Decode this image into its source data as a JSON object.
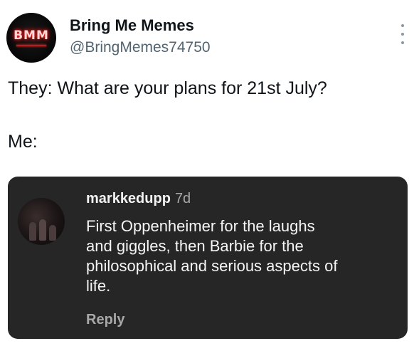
{
  "post": {
    "avatar_logo_text": "BMM",
    "display_name": "Bring Me Memes",
    "handle": "@BringMemes74750",
    "more_icon": "more-vertical-icon",
    "text_lines": [
      "They: What are your plans for 21st July?",
      "Me:"
    ]
  },
  "comment": {
    "username": "markkedupp",
    "time_ago": "7d",
    "text_lines": [
      "First Oppenheimer for the laughs",
      "and giggles, then Barbie for the",
      "philosophical and serious aspects of",
      "life."
    ],
    "reply_label": "Reply"
  },
  "colors": {
    "card_background": "#262626",
    "logo_glow": "#e30000",
    "handle_gray": "#536471"
  }
}
